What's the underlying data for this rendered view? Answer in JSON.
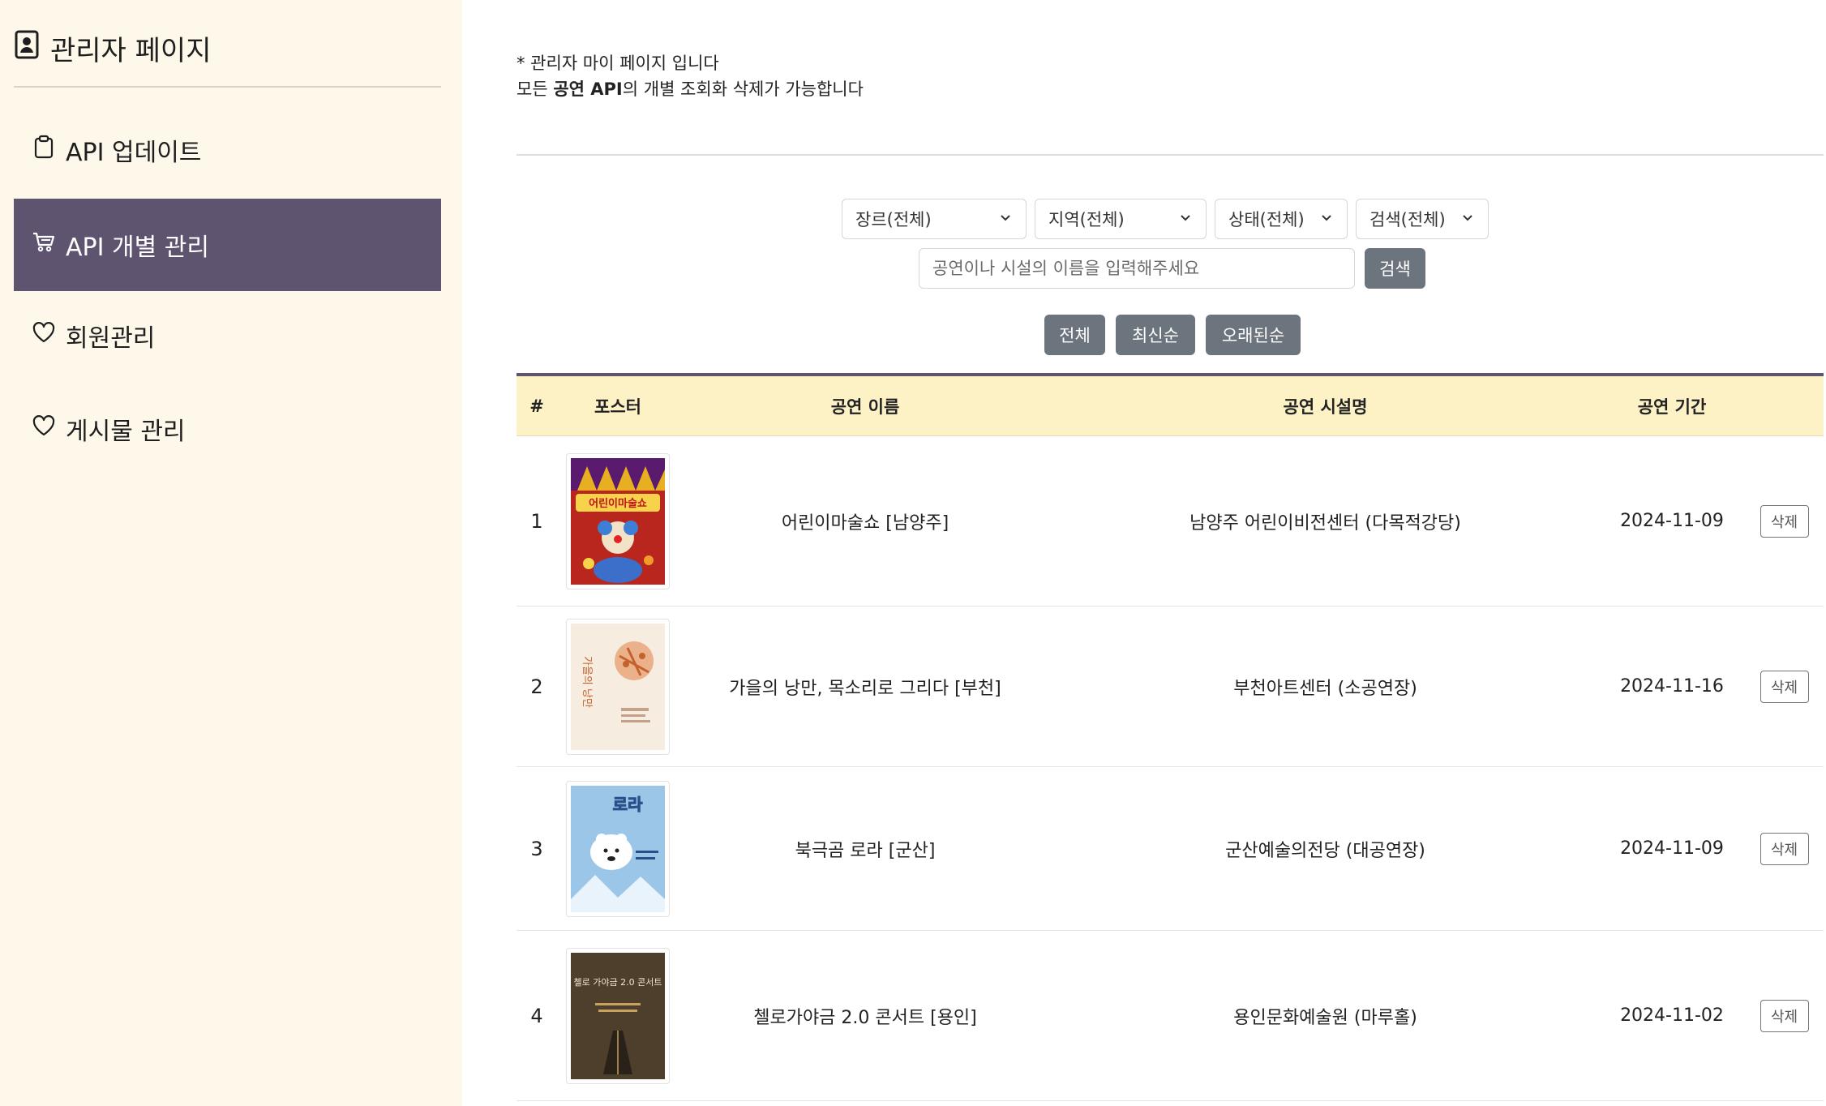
{
  "sidebar": {
    "title": "관리자 페이지",
    "items": [
      {
        "label": "API 업데이트",
        "icon": "clipboard-icon",
        "active": false
      },
      {
        "label": "API 개별 관리",
        "icon": "cart-icon",
        "active": true
      },
      {
        "label": "회원관리",
        "icon": "heart-icon",
        "active": false
      },
      {
        "label": "게시물 관리",
        "icon": "heart-icon",
        "active": false
      }
    ]
  },
  "notice": {
    "line1": "* 관리자 마이 페이지 입니다",
    "line2_pre": "모든 ",
    "line2_bold": "공연 API",
    "line2_post": "의 개별 조회화 삭제가 가능합니다"
  },
  "filters": {
    "genre": "장르(전체)",
    "region": "지역(전체)",
    "state": "상태(전체)",
    "search_type": "검색(전체)"
  },
  "search": {
    "placeholder": "공연이나 시설의 이름을 입력해주세요",
    "value": "",
    "button": "검색"
  },
  "sort": {
    "all": "전체",
    "newest": "최신순",
    "oldest": "오래된순"
  },
  "table": {
    "headers": {
      "num": "#",
      "poster": "포스터",
      "name": "공연 이름",
      "venue": "공연 시설명",
      "date": "공연 기간"
    },
    "delete_label": "삭제",
    "rows": [
      {
        "num": "1",
        "name": "어린이마술쇼 [남양주]",
        "venue": "남양주 어린이비전센터 (다목적강당)",
        "date": "2024-11-09",
        "poster": {
          "icon": "magic-show-poster",
          "title": "어린이마술쇼"
        }
      },
      {
        "num": "2",
        "name": "가을의 낭만, 목소리로 그리다 [부천]",
        "venue": "부천아트센터 (소공연장)",
        "date": "2024-11-16",
        "poster": {
          "icon": "autumn-poster",
          "title": "가을의 낭만"
        }
      },
      {
        "num": "3",
        "name": "북극곰 로라 [군산]",
        "venue": "군산예술의전당 (대공연장)",
        "date": "2024-11-09",
        "poster": {
          "icon": "polar-bear-poster",
          "title": "로라"
        }
      },
      {
        "num": "4",
        "name": "첼로가야금 2.0 콘서트 [용인]",
        "venue": "용인문화예술원 (마루홀)",
        "date": "2024-11-02",
        "poster": {
          "icon": "cello-gayageum-poster",
          "title": "첼로 가야금 2.0 콘서트"
        }
      }
    ]
  },
  "colors": {
    "sidebar_bg": "#fdf8ea",
    "active_item": "#5e5470",
    "header_bg": "#fdf1c6",
    "button": "#6c757d"
  }
}
